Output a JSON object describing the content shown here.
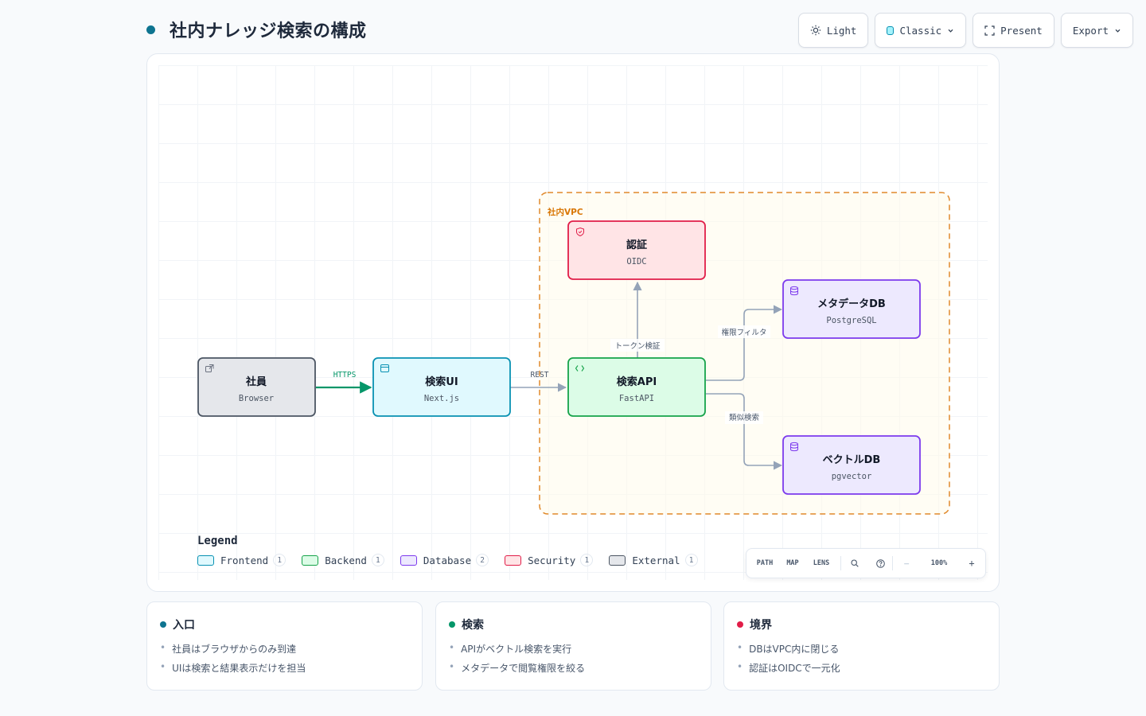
{
  "header": {
    "title": "社内ナレッジ検索の構成",
    "accent": "#0e7490"
  },
  "toolbar": {
    "theme_label": "Light",
    "style_label": "Classic",
    "present_label": "Present",
    "export_label": "Export",
    "theme_icon": "sun-icon",
    "present_icon": "fullscreen-icon",
    "dropdown_icon": "chevron-down-icon"
  },
  "diagram": {
    "group": {
      "label": "社内VPC",
      "color": "#d97706"
    },
    "nodes": {
      "employee": {
        "title": "社員",
        "subtitle": "Browser",
        "kind": "External",
        "icon": "external-link-icon"
      },
      "search_ui": {
        "title": "検索UI",
        "subtitle": "Next.js",
        "kind": "Frontend",
        "icon": "window-icon"
      },
      "search_api": {
        "title": "検索API",
        "subtitle": "FastAPI",
        "kind": "Backend",
        "icon": "code-icon"
      },
      "auth": {
        "title": "認証",
        "subtitle": "OIDC",
        "kind": "Security",
        "icon": "shield-icon"
      },
      "meta_db": {
        "title": "メタデータDB",
        "subtitle": "PostgreSQL",
        "kind": "Database",
        "icon": "database-icon"
      },
      "vector_db": {
        "title": "ベクトルDB",
        "subtitle": "pgvector",
        "kind": "Database",
        "icon": "database-icon"
      }
    },
    "edges": {
      "https": "HTTPS",
      "rest": "REST",
      "token": "トークン検証",
      "perm": "権限フィルタ",
      "similar": "類似検索"
    },
    "colors": {
      "Frontend": {
        "fill": "#e0f9fe",
        "stroke": "#0891b2"
      },
      "Backend": {
        "fill": "#dcfce7",
        "stroke": "#16a34a"
      },
      "Database": {
        "fill": "#ede9fe",
        "stroke": "#7c3aed"
      },
      "Security": {
        "fill": "#ffe4e6",
        "stroke": "#e11d48"
      },
      "External": {
        "fill": "#e5e7eb",
        "stroke": "#4b5563"
      }
    }
  },
  "legend": {
    "title": "Legend",
    "items": [
      {
        "label": "Frontend",
        "count": "1"
      },
      {
        "label": "Backend",
        "count": "1"
      },
      {
        "label": "Database",
        "count": "2"
      },
      {
        "label": "Security",
        "count": "1"
      },
      {
        "label": "External",
        "count": "1"
      }
    ]
  },
  "zoom": {
    "path_label": "PATH",
    "map_label": "MAP",
    "lens_label": "LENS",
    "level": "100%",
    "minus": "−",
    "plus": "+"
  },
  "notes": [
    {
      "title": "入口",
      "color": "#0e7490",
      "items": [
        "社員はブラウザからのみ到達",
        "UIは検索と結果表示だけを担当"
      ]
    },
    {
      "title": "検索",
      "color": "#059669",
      "items": [
        "APIがベクトル検索を実行",
        "メタデータで閲覧権限を絞る"
      ]
    },
    {
      "title": "境界",
      "color": "#e11d48",
      "items": [
        "DBはVPC内に閉じる",
        "認証はOIDCで一元化"
      ]
    }
  ]
}
